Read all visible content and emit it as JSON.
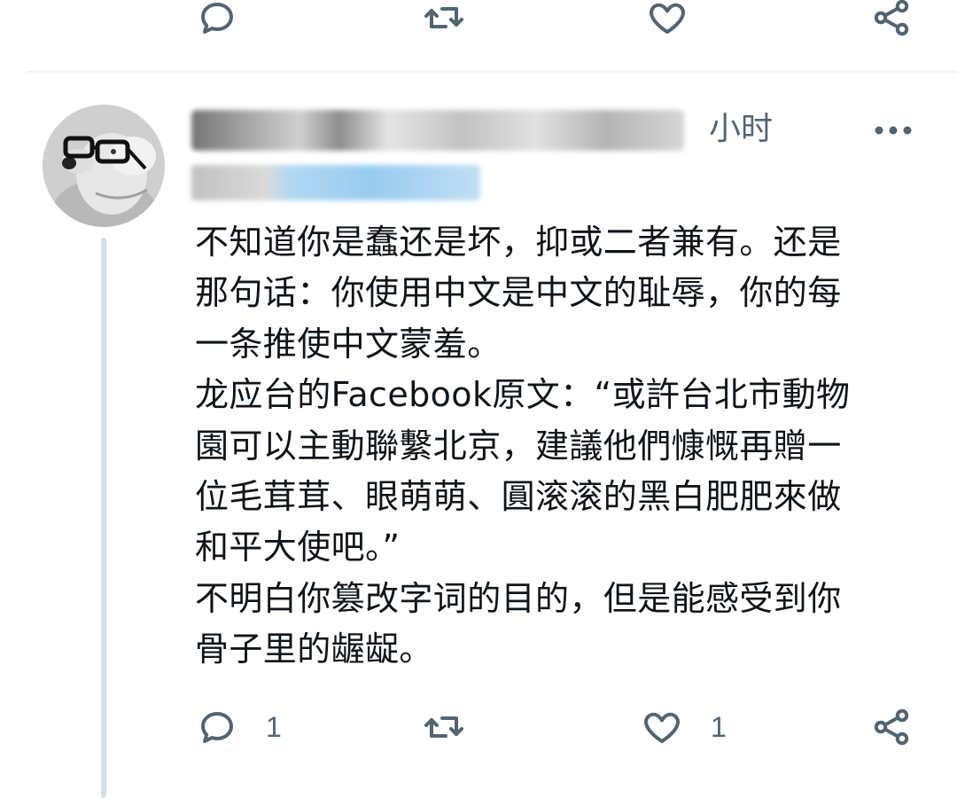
{
  "top_actions": {
    "reply_icon": "reply-icon",
    "retweet_icon": "retweet-icon",
    "like_icon": "heart-icon",
    "share_icon": "share-icon"
  },
  "tweet": {
    "time": "小时",
    "more_icon": "more-horizontal-icon",
    "text": "不知道你是蠢还是坏，抑或二者兼有。还是\n那句话：你使用中文是中文的耻辱，你的每\n一条推使中文蒙羞。\n龙应台的Facebook原文：“或許台北市動物\n園可以主動聯繫北京，建議他們慷慨再贈一\n位毛茸茸、眼萌萌、圓滚滚的黑白肥肥來做\n和平大使吧。”\n不明白你篡改字词的目的，但是能感受到你\n骨子里的龌龊。",
    "actions": {
      "reply_count": "1",
      "like_count": "1"
    }
  },
  "colors": {
    "icon": "#536471",
    "text": "#0f1419",
    "divider": "#eff3f4",
    "thread_line": "#d7dfe3"
  }
}
